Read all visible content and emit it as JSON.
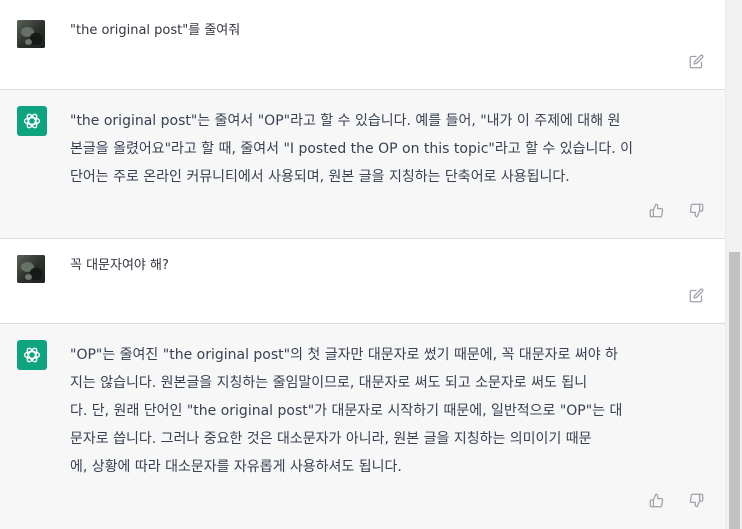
{
  "messages": [
    {
      "role": "user",
      "text": "\"the original post\"를 줄여줘",
      "avatar_icon": "user-avatar",
      "action_icon": "edit-icon"
    },
    {
      "role": "assistant",
      "text": "\"the original post\"는 줄여서 \"OP\"라고 할 수 있습니다. 예를 들어, \"내가 이 주제에 대해 원\n본글을 올렸어요\"라고 할 때, 줄여서 \"I posted the OP on this topic\"라고 할 수 있습니다. 이\n단어는 주로 온라인 커뮤니티에서 사용되며, 원본 글을 지칭하는 단축어로 사용됩니다.",
      "avatar_icon": "chatgpt-logo-icon",
      "action_icons": [
        "thumbs-up-icon",
        "thumbs-down-icon"
      ]
    },
    {
      "role": "user",
      "text": "꼭 대문자여야 해?",
      "avatar_icon": "user-avatar",
      "action_icon": "edit-icon"
    },
    {
      "role": "assistant",
      "text": "\"OP\"는 줄여진 \"the original post\"의 첫 글자만 대문자로 썼기 때문에, 꼭 대문자로 써야 하\n지는 않습니다. 원본글을 지칭하는 줄임말이므로, 대문자로 써도 되고 소문자로 써도 됩니\n다. 단, 원래 단어인 \"the original post\"가 대문자로 시작하기 때문에, 일반적으로 \"OP\"는 대\n문자로 씁니다. 그러나 중요한 것은 대소문자가 아니라, 원본 글을 지칭하는 의미이기 때문\n에, 상황에 따라 대소문자를 자유롭게 사용하셔도 됩니다.",
      "avatar_icon": "chatgpt-logo-icon",
      "action_icons": [
        "thumbs-up-icon",
        "thumbs-down-icon"
      ]
    }
  ],
  "colors": {
    "assistant_bg": "#f7f7f8",
    "user_bg": "#ffffff",
    "brand_green": "#10a37f",
    "text": "#374151",
    "icon": "#a0a0ab"
  }
}
